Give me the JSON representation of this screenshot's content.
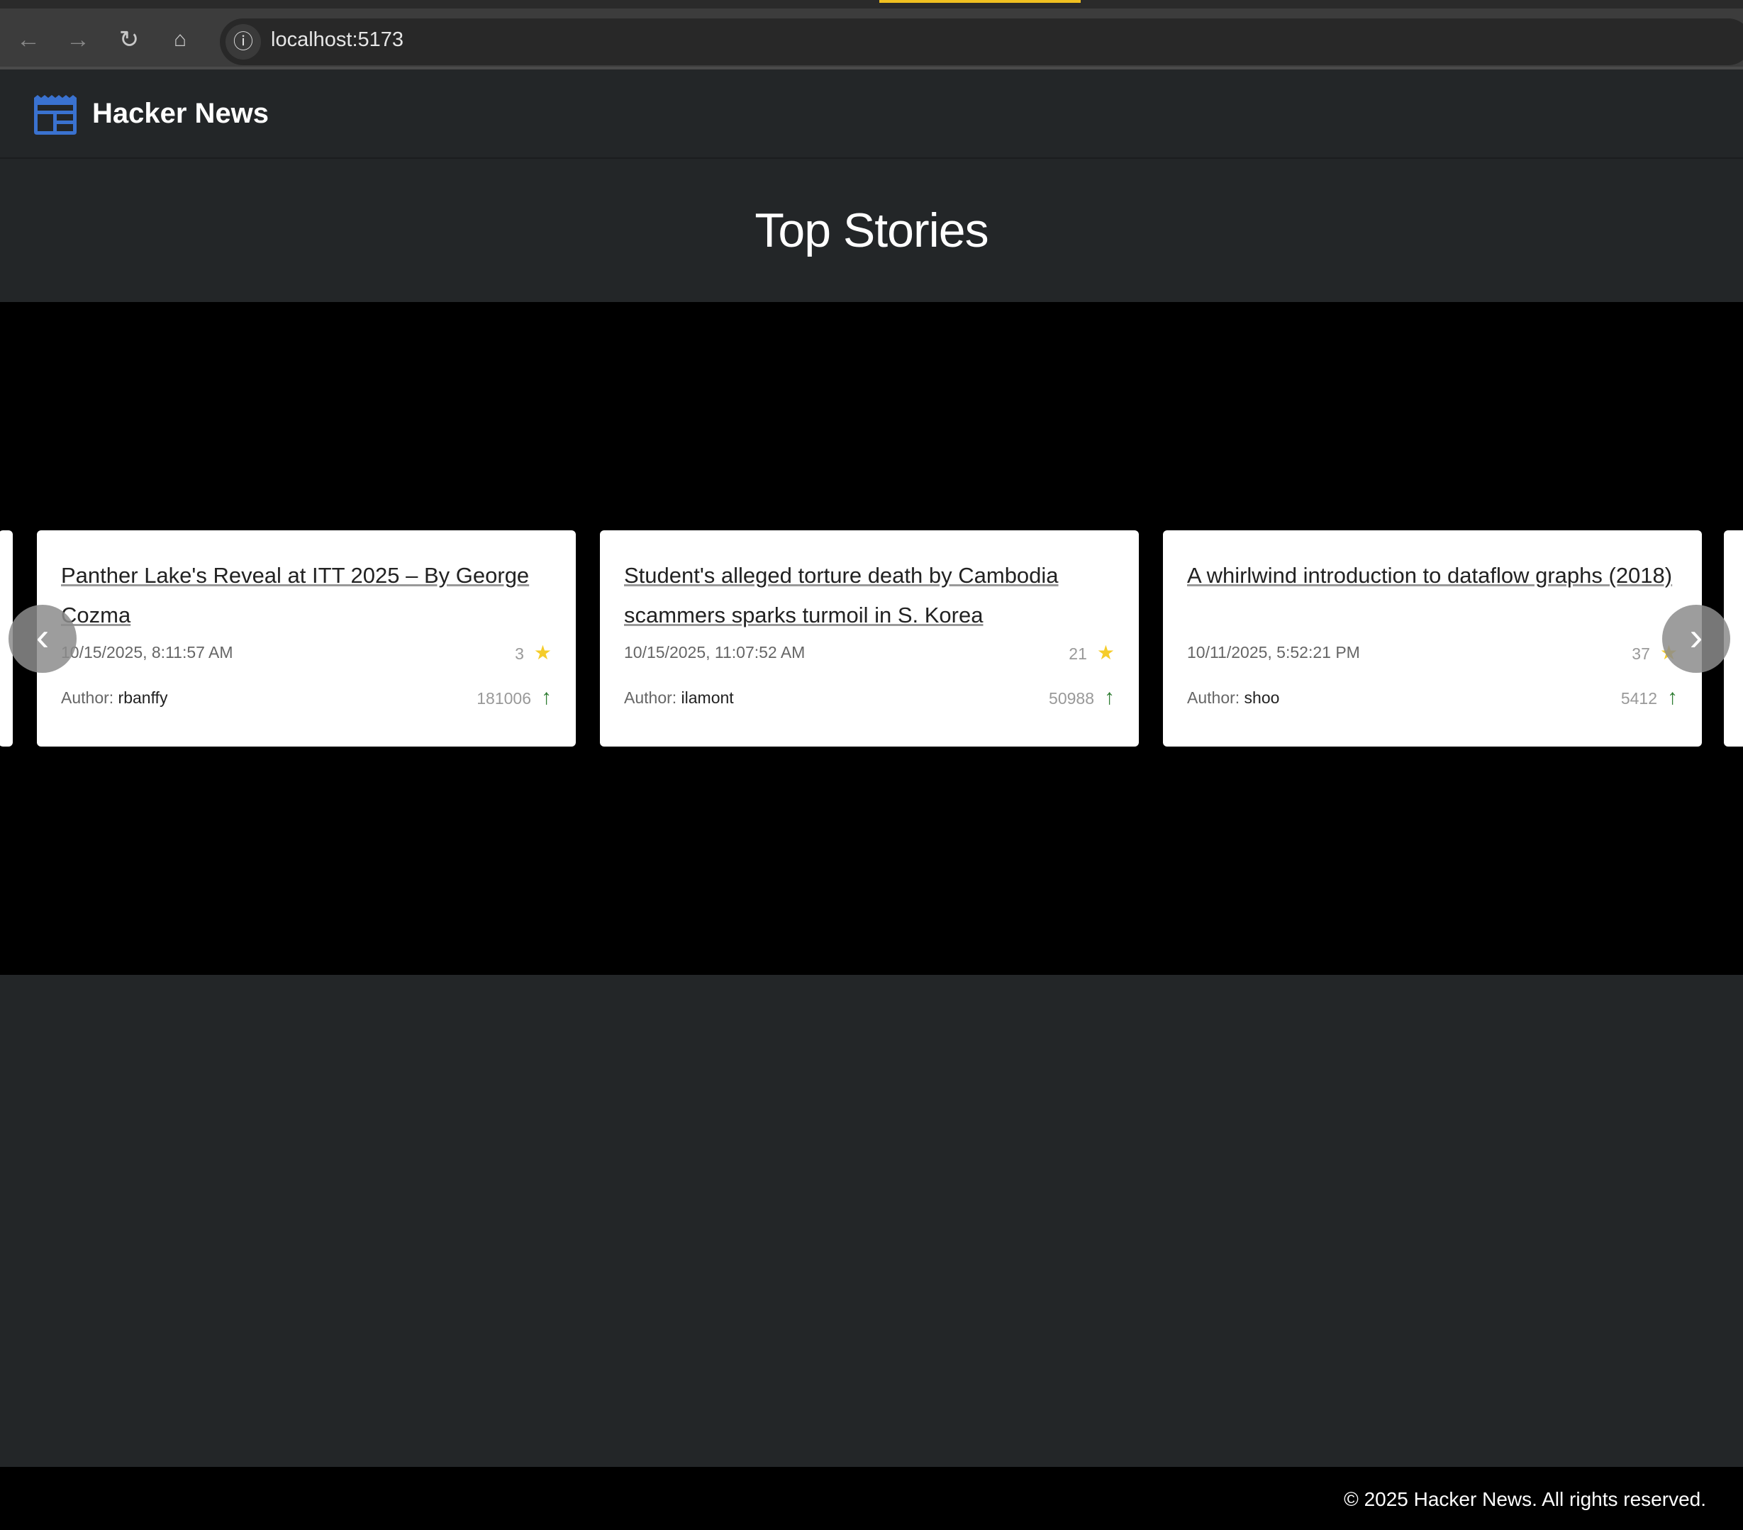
{
  "browser": {
    "url": "localhost:5173",
    "icons": [
      "back-icon",
      "forward-icon",
      "reload-icon",
      "home-icon",
      "info-icon"
    ]
  },
  "header": {
    "title": "Hacker News",
    "logo_icon": "newspaper-icon"
  },
  "page_title": "Top Stories",
  "stories": [
    {
      "title": "Panther Lake's Reveal at ITT 2025 – By George Cozma",
      "time": "10/15/2025, 8:11:57 AM",
      "author_label": "Author:",
      "author": "rbanffy",
      "score": "3",
      "id": "181006"
    },
    {
      "title": "Student's alleged torture death by Cambodia scammers sparks turmoil in S. Korea",
      "time": "10/15/2025, 11:07:52 AM",
      "author_label": "Author:",
      "author": "ilamont",
      "score": "21",
      "id": "50988"
    },
    {
      "title": "A whirlwind introduction to dataflow graphs (2018)",
      "time": "10/11/2025, 5:52:21 PM",
      "author_label": "Author:",
      "author": "shoo",
      "score": "37",
      "id": "5412"
    }
  ],
  "footer": "© 2025 Hacker News. All rights reserved.",
  "colors": {
    "accent": "#3a72d0",
    "star": "#f5cc2a",
    "upvote": "#2e7d32"
  }
}
